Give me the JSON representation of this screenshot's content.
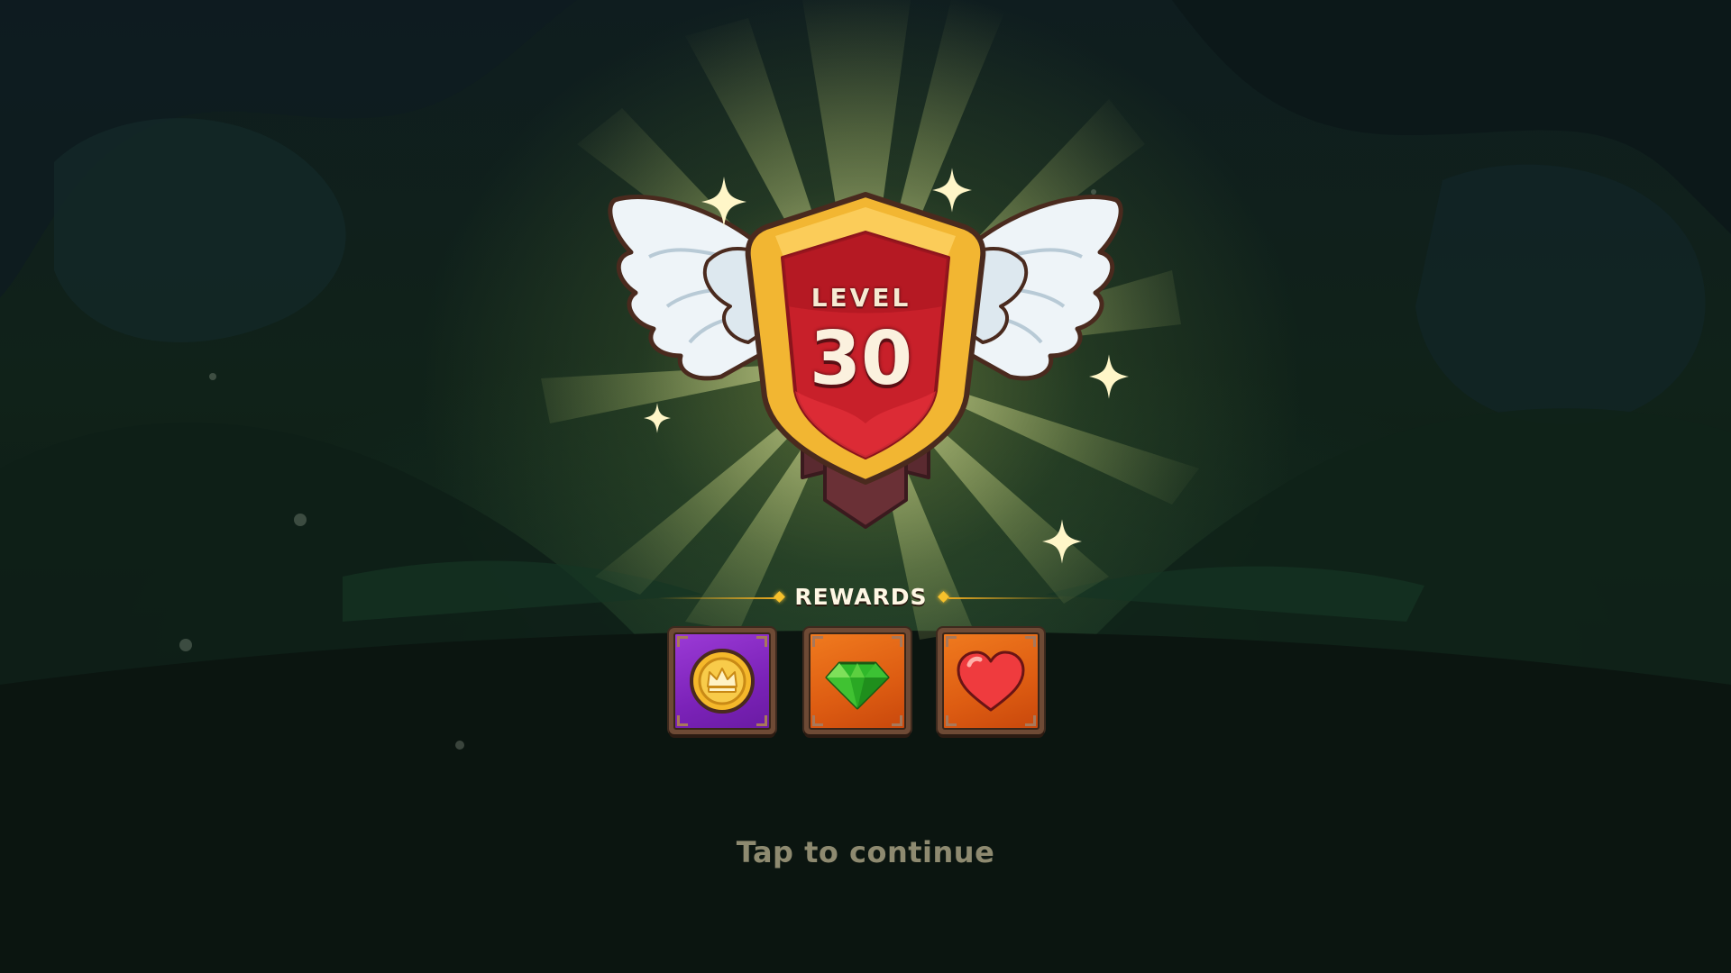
{
  "level_up": {
    "level_label": "LEVEL",
    "level_number": "30"
  },
  "rewards": {
    "title": "REWARDS",
    "items": [
      {
        "name": "Crown Coin",
        "icon": "crown-coin-icon",
        "frame_color": "#7b22b8"
      },
      {
        "name": "Green Gem",
        "icon": "green-gem-icon",
        "frame_color": "#dd5c12"
      },
      {
        "name": "Heart",
        "icon": "heart-icon",
        "frame_color": "#dd5c12"
      }
    ]
  },
  "footer": {
    "tap_to_continue": "Tap to continue"
  },
  "colors": {
    "badge_gold": "#f2b632",
    "badge_red": "#c8202a",
    "wing_white": "#eef4f8",
    "rays": "#dfe79a"
  }
}
